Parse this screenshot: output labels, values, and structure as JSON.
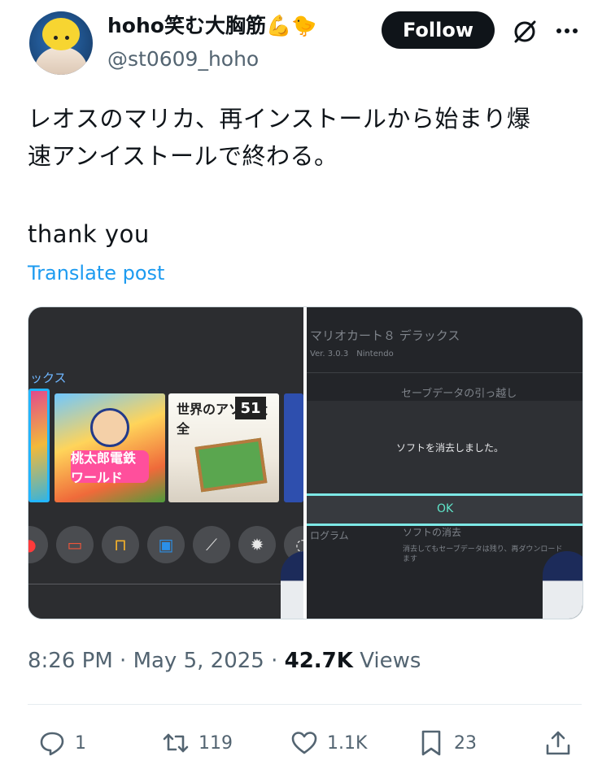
{
  "author": {
    "display_name": "hoho笑む大胸筋💪🐤",
    "handle": "@st0609_hoho"
  },
  "header": {
    "follow_label": "Follow",
    "grok_icon": "grok-icon",
    "more_icon": "more-horizontal-icon"
  },
  "post": {
    "line1": "レオスのマリカ、再インストールから始まり爆",
    "line2": "速アンイストールで終わる。",
    "line3": "thank you",
    "translate_label": "Translate post"
  },
  "media": {
    "left_screenshot": {
      "header_text": "ックス",
      "tile_b_logo": "桃太郎電鉄 ワールド",
      "tile_c_title": "世界のアソビ大全",
      "tile_c_number": "51"
    },
    "right_screenshot": {
      "title": "マリオカート８ デラックス",
      "subtitle": "Ver. 3.0.3　Nintendo",
      "section_label": "セーブデータの引っ越し",
      "dialog_message": "ソフトを消去しました。",
      "ok_label": "OK",
      "bottom_left": "ログラム",
      "bottom_right_title": "ソフトの消去",
      "bottom_right_desc": "消去してもセーブデータは残り、再ダウンロード\nます"
    }
  },
  "meta": {
    "time": "8:26 PM",
    "separator": "·",
    "date": "May 5, 2025",
    "views_count": "42.7K",
    "views_label": "Views"
  },
  "actions": {
    "replies": "1",
    "reposts": "119",
    "likes": "1.1K",
    "bookmarks": "23"
  },
  "colors": {
    "follow_bg": "#0f1419",
    "link": "#1d9bf0",
    "secondary_text": "#536471"
  }
}
